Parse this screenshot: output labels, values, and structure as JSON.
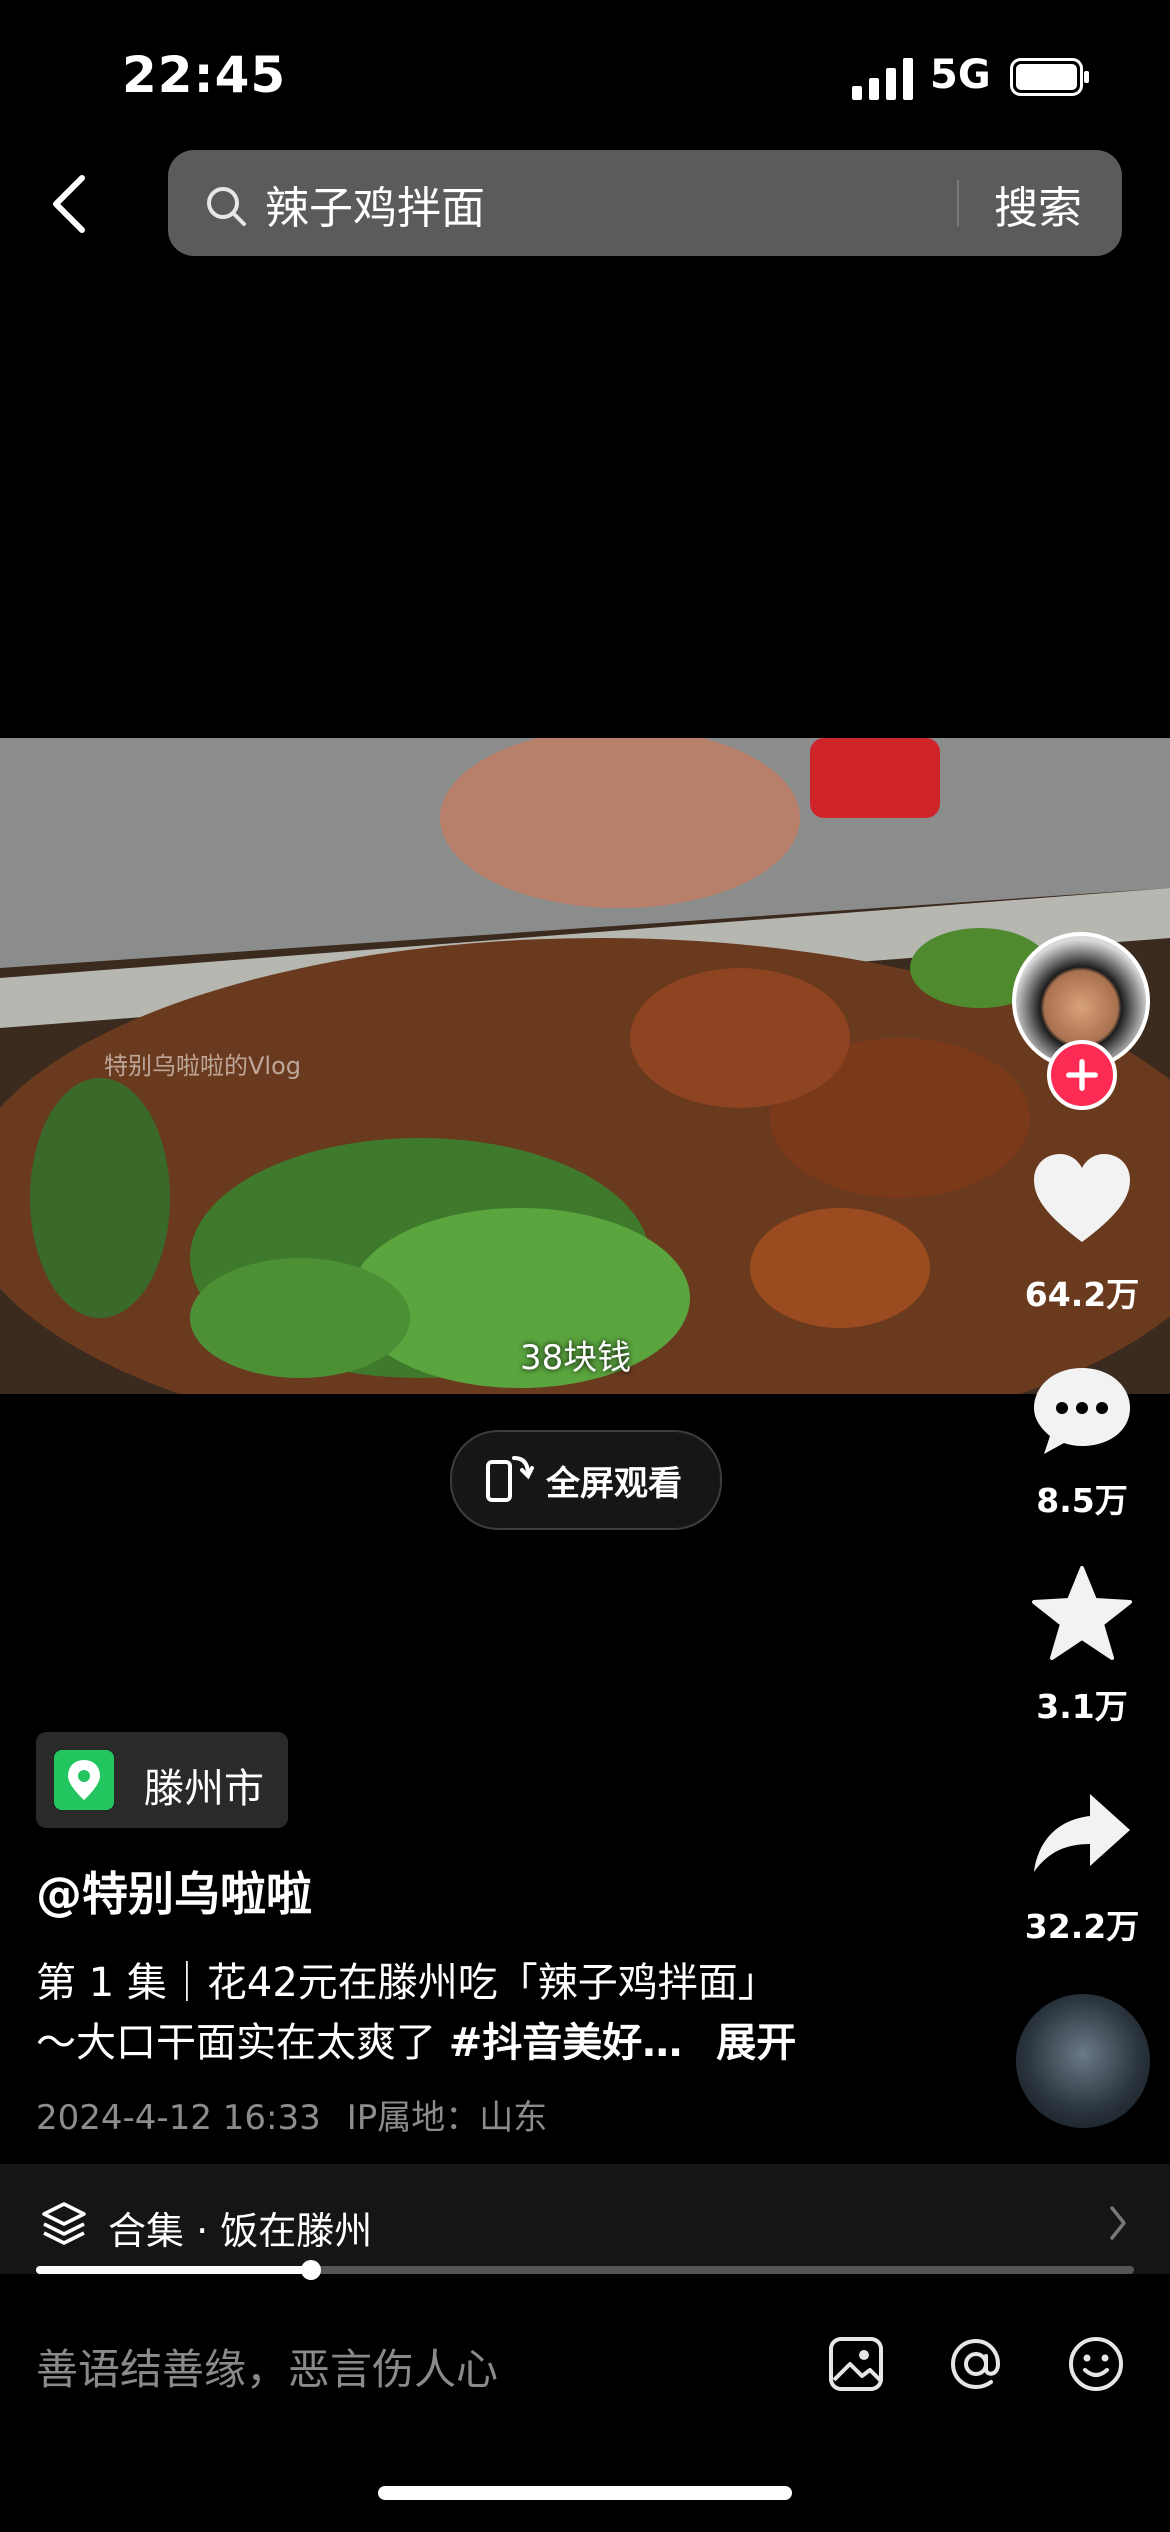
{
  "status_bar": {
    "time": "22:45",
    "network": "5G"
  },
  "search": {
    "query": "辣子鸡拌面",
    "button_label": "搜索"
  },
  "video": {
    "watermark": "特别乌啦啦的Vlog",
    "caption": "38块钱"
  },
  "fullscreen": {
    "label": "全屏观看"
  },
  "actions": {
    "likes": "64.2万",
    "comments": "8.5万",
    "favorites": "3.1万",
    "shares": "32.2万"
  },
  "location": {
    "label": "滕州市"
  },
  "post": {
    "author": "@特别乌啦啦",
    "desc_line1": "第 1 集｜花42元在滕州吃「辣子鸡拌面」",
    "desc_line2_text": "～大口干面实在太爽了 ",
    "desc_line2_tag": "#抖音美好…",
    "expand_label": "展开",
    "date_time": "2024-4-12 16:33",
    "ip_location": "IP属地：山东"
  },
  "collection": {
    "label": "合集 · 饭在滕州",
    "progress": 0.25
  },
  "comment_bar": {
    "placeholder": "善语结善缘，恶言伤人心"
  },
  "colors": {
    "accent": "#fe2c55",
    "location_green": "#22c55e",
    "background": "#000000"
  }
}
